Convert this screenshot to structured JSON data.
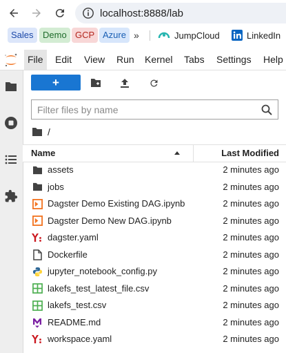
{
  "browser": {
    "url": "localhost:8888/lab",
    "bookmarks": [
      {
        "label": "Sales"
      },
      {
        "label": "Demo"
      },
      {
        "label": "GCP"
      },
      {
        "label": "Azure"
      }
    ],
    "more_label": "»",
    "links": [
      {
        "label": "JumpCloud",
        "icon": "jumpcloud-icon"
      },
      {
        "label": "LinkedIn",
        "icon": "linkedin-icon"
      }
    ]
  },
  "menubar": {
    "items": [
      "File",
      "Edit",
      "View",
      "Run",
      "Kernel",
      "Tabs",
      "Settings",
      "Help"
    ],
    "active": "File"
  },
  "file_browser": {
    "new_launcher_label": "+",
    "filter_placeholder": "Filter files by name",
    "breadcrumb_separator": "/",
    "columns": {
      "name": "Name",
      "modified": "Last Modified"
    },
    "files": [
      {
        "name": "assets",
        "type": "folder",
        "modified": "2 minutes ago"
      },
      {
        "name": "jobs",
        "type": "folder",
        "modified": "2 minutes ago"
      },
      {
        "name": "Dagster Demo Existing DAG.ipynb",
        "type": "notebook",
        "modified": "2 minutes ago"
      },
      {
        "name": "Dagster Demo New DAG.ipynb",
        "type": "notebook",
        "modified": "2 minutes ago"
      },
      {
        "name": "dagster.yaml",
        "type": "yaml",
        "modified": "2 minutes ago"
      },
      {
        "name": "Dockerfile",
        "type": "file",
        "modified": "2 minutes ago"
      },
      {
        "name": "jupyter_notebook_config.py",
        "type": "python",
        "modified": "2 minutes ago"
      },
      {
        "name": "lakefs_test_latest_file.csv",
        "type": "csv",
        "modified": "2 minutes ago"
      },
      {
        "name": "lakefs_test.csv",
        "type": "csv",
        "modified": "2 minutes ago"
      },
      {
        "name": "README.md",
        "type": "markdown",
        "modified": "2 minutes ago"
      },
      {
        "name": "workspace.yaml",
        "type": "yaml",
        "modified": "2 minutes ago"
      }
    ]
  },
  "colors": {
    "accent": "#1976d2",
    "jupyter_orange": "#f37726",
    "yaml": "#cb171e",
    "csv": "#4caf50",
    "markdown": "#7b1fa2",
    "python_blue": "#306998",
    "python_yellow": "#ffd43b"
  }
}
